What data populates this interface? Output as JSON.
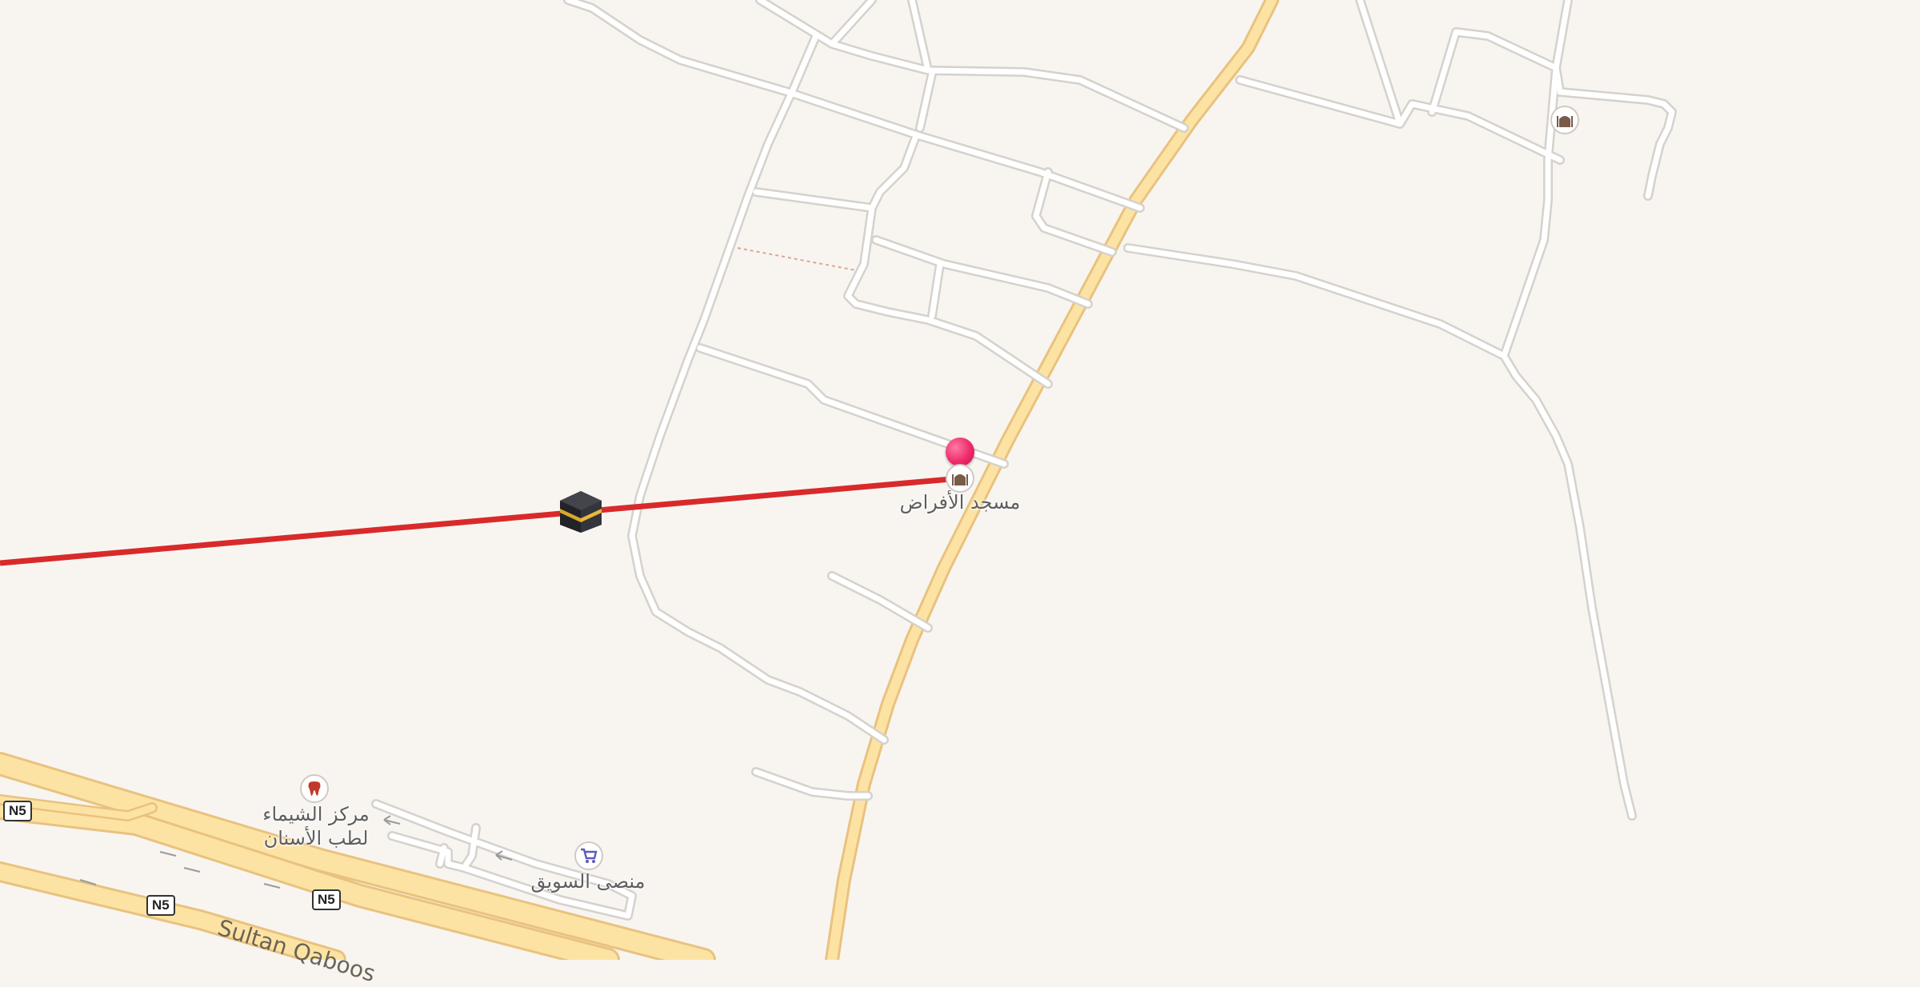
{
  "map": {
    "colors": {
      "background": "#f8f5f1",
      "route": "#d82a2a",
      "major_road": "#fde3a3",
      "pin": "#ee2a6b"
    },
    "pois": [
      {
        "label": "مسجد الأفراض",
        "icon": "mosque-icon"
      },
      {
        "label": "مركز الشيماء\nلطب الأسنان",
        "icon": "tooth-icon"
      },
      {
        "label": "منصى السويق",
        "icon": "shopping-cart-icon"
      },
      {
        "label": "",
        "icon": "mosque-icon"
      }
    ],
    "shields": [
      "N5",
      "N5",
      "N5"
    ],
    "road_names": [
      "Sultan Qaboos"
    ],
    "markers": {
      "qibla": "kaaba-icon",
      "location": "location-pin-icon"
    }
  }
}
